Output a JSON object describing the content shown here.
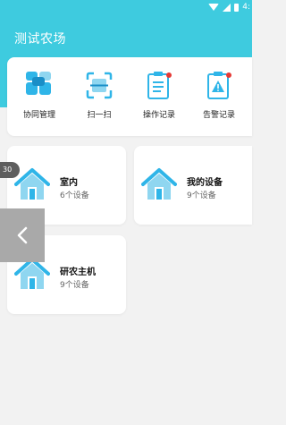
{
  "status_bar": {
    "time_partial": "4:"
  },
  "header": {
    "title": "测试农场"
  },
  "quick_actions": [
    {
      "label": "协同管理",
      "icon": "collaboration-icon"
    },
    {
      "label": "扫一扫",
      "icon": "scan-icon"
    },
    {
      "label": "操作记录",
      "icon": "operation-record-icon"
    },
    {
      "label": "告警记录",
      "icon": "alarm-record-icon"
    }
  ],
  "devices": [
    {
      "name": "室内",
      "count": "6个设备"
    },
    {
      "name": "我的设备",
      "count": "9个设备"
    },
    {
      "name": "研农主机",
      "count": "9个设备"
    }
  ],
  "float_badge": {
    "text": "30"
  },
  "colors": {
    "header": "#3ecbdf",
    "accent": "#2fb5e8",
    "alert_dot": "#e53935"
  }
}
